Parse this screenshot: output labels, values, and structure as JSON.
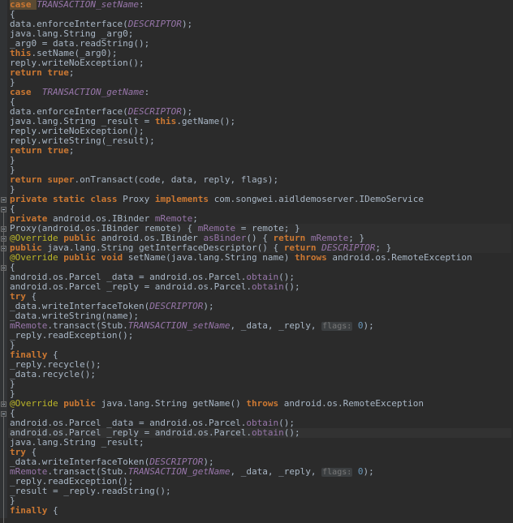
{
  "editor": {
    "theme": "darcula",
    "background": "#2b2b2b",
    "gutter_background": "#313335",
    "default_text_color": "#a9b7c6",
    "keyword_color": "#cc7832",
    "static_field_color": "#9876aa",
    "number_color": "#6897bb",
    "annotation_color": "#bbb529",
    "string_color": "#6a8759",
    "hint_color": "#787878",
    "selection_color": "#5a4a33",
    "line_height_px": 12,
    "font_size_px": 11
  },
  "fold_markers": [
    {
      "line": 20,
      "type": "minus"
    },
    {
      "line": 21,
      "type": "minus"
    },
    {
      "line": 23,
      "type": "plus"
    },
    {
      "line": 24,
      "type": "plus"
    },
    {
      "line": 25,
      "type": "plus"
    },
    {
      "line": 27,
      "type": "minus"
    },
    {
      "line": 41,
      "type": "minus"
    },
    {
      "line": 42,
      "type": "minus"
    }
  ],
  "lines": [
    {
      "n": 0,
      "highlight": "none",
      "tokens": [
        {
          "t": "case ",
          "c": "kw",
          "selected": true
        },
        {
          "t": "TRANSACTION_setName",
          "c": "stat"
        },
        {
          "t": ":",
          "c": "txt"
        }
      ]
    },
    {
      "n": 1,
      "highlight": "none",
      "tokens": [
        {
          "t": "{",
          "c": "txt"
        }
      ]
    },
    {
      "n": 2,
      "highlight": "none",
      "tokens": [
        {
          "t": "data.enforceInterface(",
          "c": "txt"
        },
        {
          "t": "DESCRIPTOR",
          "c": "stat"
        },
        {
          "t": ");",
          "c": "txt"
        }
      ]
    },
    {
      "n": 3,
      "highlight": "none",
      "tokens": [
        {
          "t": "java.lang.String _arg0;",
          "c": "txt"
        }
      ]
    },
    {
      "n": 4,
      "highlight": "none",
      "tokens": [
        {
          "t": "_arg0 = data.readString();",
          "c": "txt"
        }
      ]
    },
    {
      "n": 5,
      "highlight": "none",
      "tokens": [
        {
          "t": "this",
          "c": "kw"
        },
        {
          "t": ".setName(_arg0);",
          "c": "txt"
        }
      ]
    },
    {
      "n": 6,
      "highlight": "none",
      "tokens": [
        {
          "t": "reply.writeNoException();",
          "c": "txt"
        }
      ]
    },
    {
      "n": 7,
      "highlight": "none",
      "tokens": [
        {
          "t": "return ",
          "c": "kw"
        },
        {
          "t": "true",
          "c": "kw"
        },
        {
          "t": ";",
          "c": "txt"
        }
      ]
    },
    {
      "n": 8,
      "highlight": "none",
      "tokens": [
        {
          "t": "}",
          "c": "txt"
        }
      ]
    },
    {
      "n": 9,
      "highlight": "none",
      "tokens": [
        {
          "t": "case ",
          "c": "kw"
        },
        {
          "t": " TRANSACTION_getName",
          "c": "stat"
        },
        {
          "t": ":",
          "c": "txt"
        }
      ]
    },
    {
      "n": 10,
      "highlight": "none",
      "tokens": [
        {
          "t": "{",
          "c": "txt"
        }
      ]
    },
    {
      "n": 11,
      "highlight": "none",
      "tokens": [
        {
          "t": "data.enforceInterface(",
          "c": "txt"
        },
        {
          "t": "DESCRIPTOR",
          "c": "stat"
        },
        {
          "t": ");",
          "c": "txt"
        }
      ]
    },
    {
      "n": 12,
      "highlight": "none",
      "tokens": [
        {
          "t": "java.lang.String _result = ",
          "c": "txt"
        },
        {
          "t": "this",
          "c": "kw"
        },
        {
          "t": ".getName();",
          "c": "txt"
        }
      ]
    },
    {
      "n": 13,
      "highlight": "none",
      "tokens": [
        {
          "t": "reply.writeNoException();",
          "c": "txt"
        }
      ]
    },
    {
      "n": 14,
      "highlight": "none",
      "tokens": [
        {
          "t": "reply.writeString(_result);",
          "c": "txt"
        }
      ]
    },
    {
      "n": 15,
      "highlight": "none",
      "tokens": [
        {
          "t": "return ",
          "c": "kw"
        },
        {
          "t": "true",
          "c": "kw"
        },
        {
          "t": ";",
          "c": "txt"
        }
      ]
    },
    {
      "n": 16,
      "highlight": "none",
      "tokens": [
        {
          "t": "}",
          "c": "txt"
        }
      ]
    },
    {
      "n": 17,
      "highlight": "none",
      "tokens": [
        {
          "t": "}",
          "c": "txt"
        }
      ]
    },
    {
      "n": 18,
      "highlight": "none",
      "tokens": [
        {
          "t": "return ",
          "c": "kw"
        },
        {
          "t": "super",
          "c": "kw"
        },
        {
          "t": ".onTransact(code, data, reply, flags);",
          "c": "txt"
        }
      ]
    },
    {
      "n": 19,
      "highlight": "none",
      "tokens": [
        {
          "t": "}",
          "c": "txt"
        }
      ]
    },
    {
      "n": 20,
      "highlight": "none",
      "tokens": [
        {
          "t": "private static class ",
          "c": "kw"
        },
        {
          "t": "Proxy ",
          "c": "txt"
        },
        {
          "t": "implements ",
          "c": "kw"
        },
        {
          "t": "com.songwei.aidldemoserver.IDemoService",
          "c": "txt"
        }
      ]
    },
    {
      "n": 21,
      "highlight": "none",
      "tokens": [
        {
          "t": "{",
          "c": "txt"
        }
      ]
    },
    {
      "n": 22,
      "highlight": "none",
      "tokens": [
        {
          "t": "private ",
          "c": "kw"
        },
        {
          "t": "android.os.IBinder ",
          "c": "txt"
        },
        {
          "t": "mRemote",
          "c": "fld"
        },
        {
          "t": ";",
          "c": "txt"
        }
      ]
    },
    {
      "n": 23,
      "highlight": "fold",
      "tokens": [
        {
          "t": "Proxy(android.os.IBinder remote)",
          "c": "txt"
        },
        {
          "t": " { ",
          "c": "txt"
        },
        {
          "t": "mRemote",
          "c": "fld"
        },
        {
          "t": " = remote; }",
          "c": "txt"
        }
      ]
    },
    {
      "n": 24,
      "highlight": "fold",
      "tokens": [
        {
          "t": "@Override",
          "c": "ann"
        },
        {
          "t": " ",
          "c": "txt"
        },
        {
          "t": "public ",
          "c": "kw"
        },
        {
          "t": "android.os.IBinder ",
          "c": "txt"
        },
        {
          "t": "asBinder",
          "c": "fld"
        },
        {
          "t": "() { ",
          "c": "txt"
        },
        {
          "t": "return ",
          "c": "kw"
        },
        {
          "t": "mRemote",
          "c": "fld"
        },
        {
          "t": "; }",
          "c": "txt"
        }
      ]
    },
    {
      "n": 25,
      "highlight": "fold",
      "tokens": [
        {
          "t": "public ",
          "c": "kw"
        },
        {
          "t": "java.lang.String ",
          "c": "txt"
        },
        {
          "t": "getInterfaceDescriptor",
          "c": "txt"
        },
        {
          "t": "() { ",
          "c": "txt"
        },
        {
          "t": "return ",
          "c": "kw"
        },
        {
          "t": "DESCRIPTOR",
          "c": "stat"
        },
        {
          "t": "; }",
          "c": "txt"
        }
      ]
    },
    {
      "n": 26,
      "highlight": "none",
      "tokens": [
        {
          "t": "@Override",
          "c": "ann"
        },
        {
          "t": " ",
          "c": "txt"
        },
        {
          "t": "public void ",
          "c": "kw"
        },
        {
          "t": "setName(java.lang.String name) ",
          "c": "txt"
        },
        {
          "t": "throws ",
          "c": "kw"
        },
        {
          "t": "android.os.RemoteException",
          "c": "txt"
        }
      ]
    },
    {
      "n": 27,
      "highlight": "none",
      "tokens": [
        {
          "t": "{",
          "c": "txt"
        }
      ]
    },
    {
      "n": 28,
      "highlight": "none",
      "tokens": [
        {
          "t": "android.os.Parcel _data = android.os.Parcel.",
          "c": "txt"
        },
        {
          "t": "obtain",
          "c": "statc"
        },
        {
          "t": "();",
          "c": "txt"
        }
      ]
    },
    {
      "n": 29,
      "highlight": "none",
      "tokens": [
        {
          "t": "android.os.Parcel _reply = android.os.Parcel.",
          "c": "txt"
        },
        {
          "t": "obtain",
          "c": "statc"
        },
        {
          "t": "();",
          "c": "txt"
        }
      ]
    },
    {
      "n": 30,
      "highlight": "none",
      "tokens": [
        {
          "t": "try ",
          "c": "kw"
        },
        {
          "t": "{",
          "c": "txt"
        }
      ]
    },
    {
      "n": 31,
      "highlight": "none",
      "tokens": [
        {
          "t": "_data.writeInterfaceToken(",
          "c": "txt"
        },
        {
          "t": "DESCRIPTOR",
          "c": "stat"
        },
        {
          "t": ");",
          "c": "txt"
        }
      ]
    },
    {
      "n": 32,
      "highlight": "none",
      "tokens": [
        {
          "t": "_data.writeString(name);",
          "c": "txt"
        }
      ]
    },
    {
      "n": 33,
      "highlight": "none",
      "tokens": [
        {
          "t": "mRemote",
          "c": "fld"
        },
        {
          "t": ".transact(Stub.",
          "c": "txt"
        },
        {
          "t": "TRANSACTION_setName",
          "c": "stat"
        },
        {
          "t": ", _data, _reply, ",
          "c": "txt"
        },
        {
          "t": "flags:",
          "c": "hint"
        },
        {
          "t": " ",
          "c": "txt"
        },
        {
          "t": "0",
          "c": "num"
        },
        {
          "t": ");",
          "c": "txt"
        }
      ]
    },
    {
      "n": 34,
      "highlight": "none",
      "tokens": [
        {
          "t": "_reply.readException();",
          "c": "txt"
        }
      ]
    },
    {
      "n": 35,
      "highlight": "none",
      "tokens": [
        {
          "t": "}",
          "c": "txt"
        }
      ]
    },
    {
      "n": 36,
      "highlight": "none",
      "tokens": [
        {
          "t": "finally ",
          "c": "kw"
        },
        {
          "t": "{",
          "c": "txt"
        }
      ]
    },
    {
      "n": 37,
      "highlight": "none",
      "tokens": [
        {
          "t": "_reply.recycle();",
          "c": "txt"
        }
      ]
    },
    {
      "n": 38,
      "highlight": "none",
      "tokens": [
        {
          "t": "_data.recycle();",
          "c": "txt"
        }
      ]
    },
    {
      "n": 39,
      "highlight": "none",
      "tokens": [
        {
          "t": "}",
          "c": "txt"
        }
      ]
    },
    {
      "n": 40,
      "highlight": "none",
      "tokens": [
        {
          "t": "}",
          "c": "txt"
        }
      ]
    },
    {
      "n": 41,
      "highlight": "none",
      "tokens": [
        {
          "t": "@Override",
          "c": "ann"
        },
        {
          "t": " ",
          "c": "txt"
        },
        {
          "t": "public ",
          "c": "kw"
        },
        {
          "t": "java.lang.String ",
          "c": "txt"
        },
        {
          "t": "getName() ",
          "c": "txt"
        },
        {
          "t": "throws ",
          "c": "kw"
        },
        {
          "t": "android.os.RemoteException",
          "c": "txt"
        }
      ]
    },
    {
      "n": 42,
      "highlight": "none",
      "tokens": [
        {
          "t": "{",
          "c": "txt"
        }
      ]
    },
    {
      "n": 43,
      "highlight": "none",
      "tokens": [
        {
          "t": "android.os.Parcel _data = android.os.Parcel.",
          "c": "txt"
        },
        {
          "t": "obtain",
          "c": "statc"
        },
        {
          "t": "();",
          "c": "txt"
        }
      ]
    },
    {
      "n": 44,
      "highlight": "row",
      "tokens": [
        {
          "t": "android.os.Parcel _reply = android.os.Parcel.",
          "c": "txt"
        },
        {
          "t": "obtain",
          "c": "statc"
        },
        {
          "t": "();",
          "c": "txt"
        }
      ]
    },
    {
      "n": 45,
      "highlight": "none",
      "tokens": [
        {
          "t": "java.lang.String _result;",
          "c": "txt"
        }
      ]
    },
    {
      "n": 46,
      "highlight": "none",
      "tokens": [
        {
          "t": "try ",
          "c": "kw"
        },
        {
          "t": "{",
          "c": "txt"
        }
      ]
    },
    {
      "n": 47,
      "highlight": "none",
      "tokens": [
        {
          "t": "_data.writeInterfaceToken(",
          "c": "txt"
        },
        {
          "t": "DESCRIPTOR",
          "c": "stat"
        },
        {
          "t": ");",
          "c": "txt"
        }
      ]
    },
    {
      "n": 48,
      "highlight": "none",
      "tokens": [
        {
          "t": "mRemote",
          "c": "fld"
        },
        {
          "t": ".transact(Stub.",
          "c": "txt"
        },
        {
          "t": "TRANSACTION_getName",
          "c": "stat"
        },
        {
          "t": ", _data, _reply, ",
          "c": "txt"
        },
        {
          "t": "flags:",
          "c": "hint"
        },
        {
          "t": " ",
          "c": "txt"
        },
        {
          "t": "0",
          "c": "num"
        },
        {
          "t": ");",
          "c": "txt"
        }
      ]
    },
    {
      "n": 49,
      "highlight": "none",
      "tokens": [
        {
          "t": "_reply.readException();",
          "c": "txt"
        }
      ]
    },
    {
      "n": 50,
      "highlight": "none",
      "tokens": [
        {
          "t": "_result = _reply.readString();",
          "c": "txt"
        }
      ]
    },
    {
      "n": 51,
      "highlight": "none",
      "tokens": [
        {
          "t": "}",
          "c": "txt"
        }
      ]
    },
    {
      "n": 52,
      "highlight": "none",
      "tokens": [
        {
          "t": "finally ",
          "c": "kw"
        },
        {
          "t": "{",
          "c": "txt"
        }
      ]
    }
  ]
}
